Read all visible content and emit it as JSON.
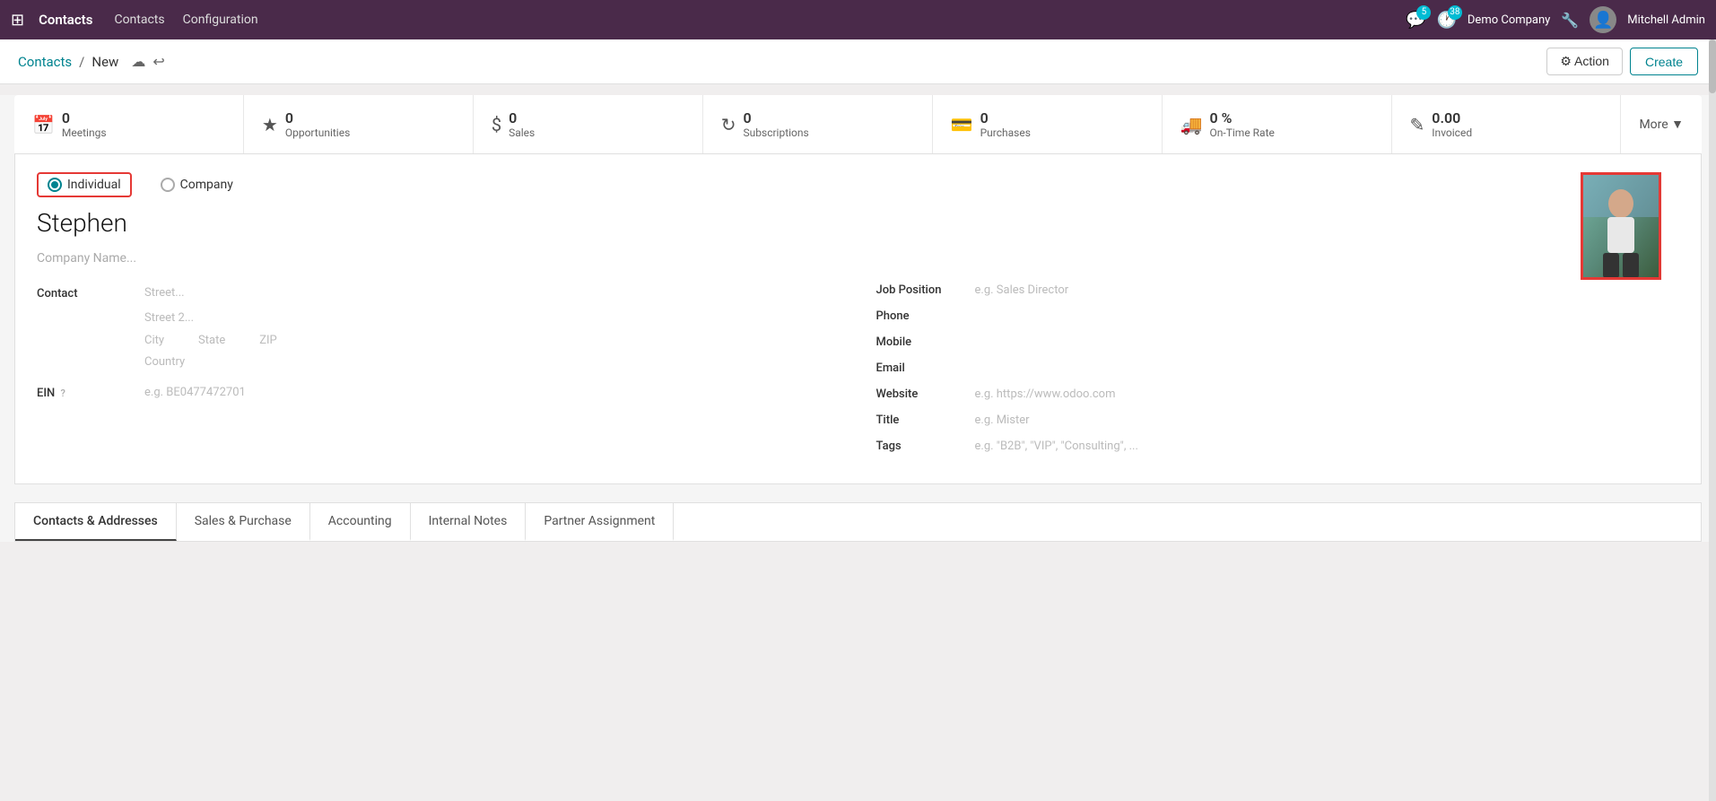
{
  "topnav": {
    "apps_icon": "⊞",
    "brand": "Contacts",
    "links": [
      "Contacts",
      "Configuration"
    ],
    "messages_count": "5",
    "activities_count": "38",
    "company": "Demo Company",
    "admin": "Mitchell Admin"
  },
  "breadcrumb": {
    "parent": "Contacts",
    "separator": "/",
    "current": "New"
  },
  "toolbar": {
    "action_label": "⚙ Action",
    "create_label": "Create"
  },
  "stats": [
    {
      "icon": "📅",
      "number": "0",
      "label": "Meetings"
    },
    {
      "icon": "★",
      "number": "0",
      "label": "Opportunities"
    },
    {
      "icon": "$",
      "number": "0",
      "label": "Sales"
    },
    {
      "icon": "↻",
      "number": "0",
      "label": "Subscriptions"
    },
    {
      "icon": "💳",
      "number": "0",
      "label": "Purchases"
    },
    {
      "icon": "🚚",
      "number": "0 %",
      "label": "On-Time Rate"
    },
    {
      "icon": "✎",
      "number": "0.00",
      "label": "Invoiced"
    }
  ],
  "more_label": "More ▼",
  "form": {
    "type_individual": "Individual",
    "type_company": "Company",
    "name": "Stephen",
    "company_name_placeholder": "Company Name...",
    "contact_label": "Contact",
    "street_placeholder": "Street...",
    "street2_placeholder": "Street 2...",
    "city_placeholder": "City",
    "state_placeholder": "State",
    "zip_placeholder": "ZIP",
    "country_placeholder": "Country",
    "ein_label": "EIN",
    "ein_tooltip": "?",
    "ein_placeholder": "e.g. BE0477472701",
    "job_position_label": "Job Position",
    "job_position_placeholder": "e.g. Sales Director",
    "phone_label": "Phone",
    "mobile_label": "Mobile",
    "email_label": "Email",
    "website_label": "Website",
    "website_placeholder": "e.g. https://www.odoo.com",
    "title_label": "Title",
    "title_placeholder": "e.g. Mister",
    "tags_label": "Tags",
    "tags_placeholder": "e.g. \"B2B\", \"VIP\", \"Consulting\", ..."
  },
  "tabs": [
    "Contacts & Addresses",
    "Sales & Purchase",
    "Accounting",
    "Internal Notes",
    "Partner Assignment"
  ]
}
